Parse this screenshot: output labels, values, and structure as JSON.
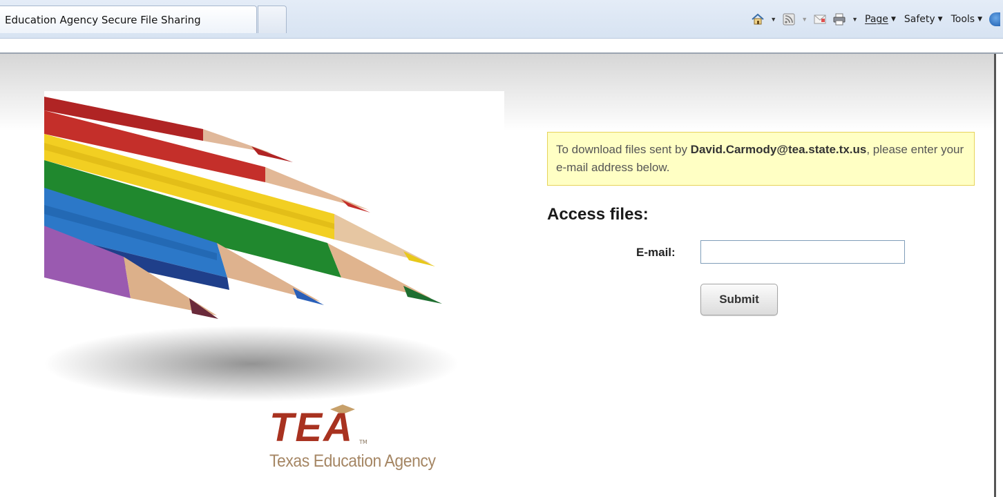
{
  "browser": {
    "active_tab_title": "Education Agency Secure File Sharing",
    "menus": {
      "page": "Page",
      "safety": "Safety",
      "tools": "Tools"
    },
    "icons": [
      "home-icon",
      "feeds-icon",
      "read-mail-icon",
      "print-icon",
      "help-icon"
    ]
  },
  "logo": {
    "letters": "TEA",
    "tm": "TM",
    "name": "Texas Education Agency"
  },
  "notice": {
    "prefix": "To download files sent by ",
    "sender": "David.Carmody@tea.state.tx.us",
    "suffix": ", please enter your e-mail address below."
  },
  "form": {
    "heading": "Access files:",
    "email_label": "E-mail:",
    "email_value": "",
    "submit_label": "Submit"
  },
  "colors": {
    "notice_bg": "#ffffc4",
    "notice_border": "#e6d35a",
    "logo_red": "#a83220",
    "logo_tan": "#a58664"
  }
}
